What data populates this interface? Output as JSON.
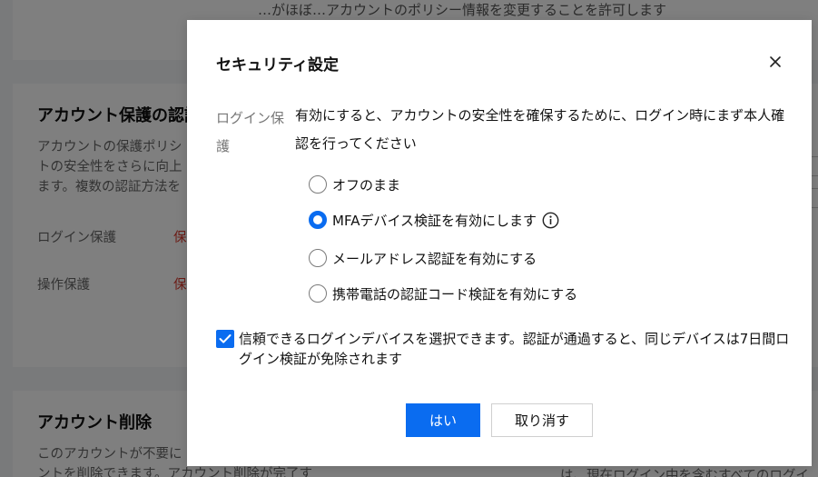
{
  "background": {
    "top_note": "…がほぼ…アカウントのポリシー情報を変更することを許可します",
    "account_protection": {
      "title": "アカウント保護の認証",
      "desc_lines": [
        "アカウントの保護ポリシ",
        "トの安全性をさらに向上",
        "ます。複数の認証方法を"
      ],
      "rows": [
        {
          "label": "ログイン保護",
          "value": "保"
        },
        {
          "label": "操作保護",
          "value": "保"
        }
      ]
    },
    "account_deletion": {
      "title": "アカウント削除",
      "desc_lines": [
        "このアカウントが不要に",
        "ントを削除できます。アカウント削除が完了す"
      ],
      "right_text": "は、現在ログイン中を含むすべてのログイ"
    }
  },
  "dialog": {
    "title": "セキュリティ設定",
    "close_icon": "close-icon",
    "section_label": "ログイン保護",
    "section_desc": "有効にすると、アカウントの安全性を確保するために、ログイン時にまず本人確認を行ってください",
    "options": [
      {
        "label": "オフのまま",
        "checked": false
      },
      {
        "label": "MFAデバイス検証を有効にします",
        "checked": true,
        "has_info": true
      },
      {
        "label": "メールアドレス認証を有効にする",
        "checked": false
      },
      {
        "label": "携帯電話の認証コード検証を有効にする",
        "checked": false
      }
    ],
    "trusted_device": {
      "checked": true,
      "label": "信頼できるログインデバイスを選択できます。認証が通過すると、同じデバイスは7日間ログイン検証が免除されます"
    },
    "confirm_label": "はい",
    "cancel_label": "取り消す"
  },
  "colors": {
    "accent": "#0a6cf0",
    "danger": "#d9372b"
  }
}
